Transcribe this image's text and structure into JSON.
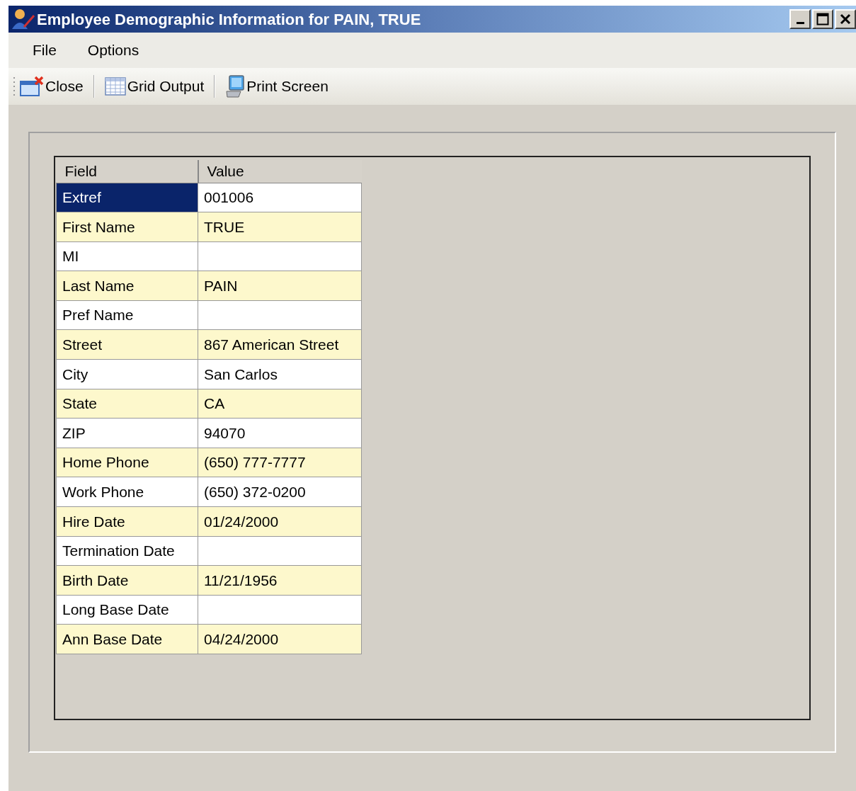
{
  "window": {
    "title": "Employee Demographic Information for PAIN, TRUE"
  },
  "menu": [
    "File",
    "Options"
  ],
  "toolbar": [
    {
      "label": "Close",
      "kind": "close"
    },
    {
      "label": "Grid Output",
      "kind": "grid"
    },
    {
      "label": "Print Screen",
      "kind": "print"
    }
  ],
  "table": {
    "columns": [
      "Field",
      "Value"
    ],
    "rows": [
      {
        "field": "Extref",
        "value": "001006",
        "selected": true
      },
      {
        "field": "First Name",
        "value": "TRUE",
        "selected": false
      },
      {
        "field": "MI",
        "value": "",
        "selected": false
      },
      {
        "field": "Last Name",
        "value": "PAIN",
        "selected": false
      },
      {
        "field": "Pref Name",
        "value": "",
        "selected": false
      },
      {
        "field": "Street",
        "value": "867 American Street",
        "selected": false
      },
      {
        "field": "City",
        "value": "San Carlos",
        "selected": false
      },
      {
        "field": "State",
        "value": "CA",
        "selected": false
      },
      {
        "field": "ZIP",
        "value": "94070",
        "selected": false
      },
      {
        "field": "Home Phone",
        "value": "(650) 777-7777",
        "selected": false
      },
      {
        "field": "Work Phone",
        "value": "(650) 372-0200",
        "selected": false
      },
      {
        "field": "Hire Date",
        "value": "01/24/2000",
        "selected": false
      },
      {
        "field": "Termination Date",
        "value": "",
        "selected": false
      },
      {
        "field": "Birth Date",
        "value": "11/21/1956",
        "selected": false
      },
      {
        "field": "Long Base Date",
        "value": "",
        "selected": false
      },
      {
        "field": "Ann Base Date",
        "value": "04/24/2000",
        "selected": false
      }
    ]
  }
}
